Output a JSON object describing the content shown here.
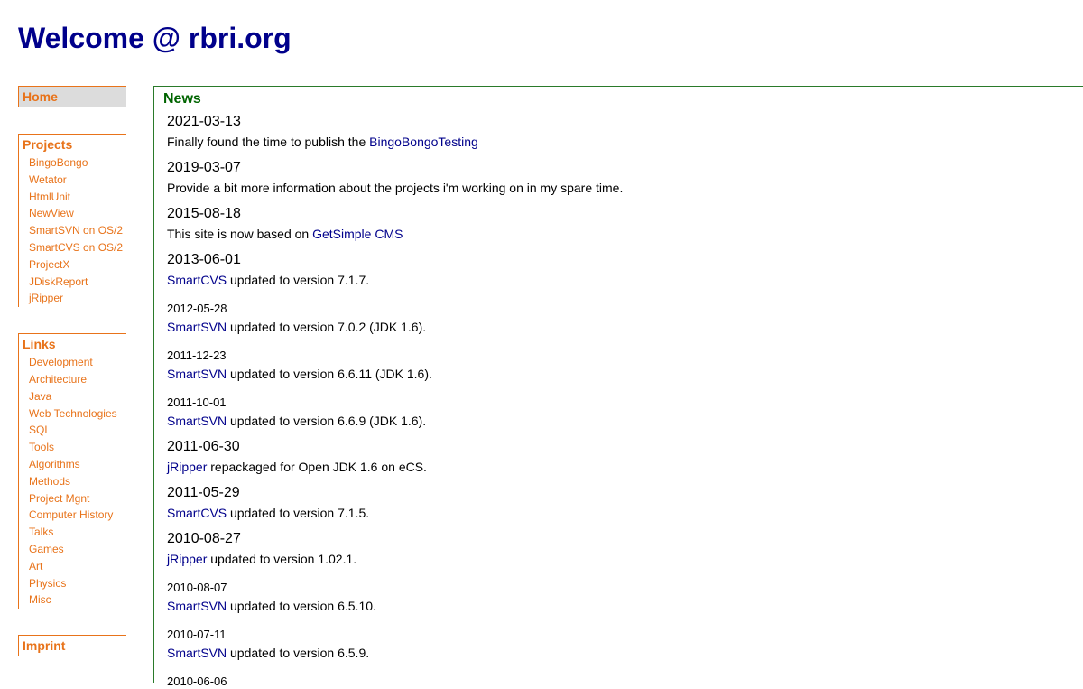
{
  "header": {
    "title": "Welcome @ rbri.org"
  },
  "sidebar": {
    "home": "Home",
    "projects": {
      "heading": "Projects",
      "items": [
        "BingoBongo",
        "Wetator",
        "HtmlUnit",
        "NewView",
        "SmartSVN on OS/2",
        "SmartCVS on OS/2",
        "ProjectX",
        "JDiskReport",
        "jRipper"
      ]
    },
    "links": {
      "heading": "Links",
      "items": [
        "Development",
        "Architecture",
        "Java",
        "Web Technologies",
        "SQL",
        "Tools",
        "Algorithms",
        "Methods",
        "Project Mgnt",
        "Computer History",
        "Talks",
        "Games",
        "Art",
        "Physics",
        "Misc"
      ]
    },
    "imprint": "Imprint"
  },
  "news": {
    "heading": "News",
    "items": [
      {
        "date": "2021-03-13",
        "size": "big",
        "pre": "Finally found the time to publish the ",
        "link": "BingoBongoTesting",
        "post": ""
      },
      {
        "date": "2019-03-07",
        "size": "big",
        "pre": "Provide a bit more information about the projects i'm working on in my spare time.",
        "link": "",
        "post": ""
      },
      {
        "date": "2015-08-18",
        "size": "big",
        "pre": "This site is now based on ",
        "link": "GetSimple CMS",
        "post": ""
      },
      {
        "date": "2013-06-01",
        "size": "big",
        "pre": "",
        "link": "SmartCVS",
        "post": " updated to version 7.1.7."
      },
      {
        "date": "2012-05-28",
        "size": "small",
        "pre": "",
        "link": "SmartSVN",
        "post": " updated to version 7.0.2 (JDK 1.6)."
      },
      {
        "date": "2011-12-23",
        "size": "small",
        "pre": "",
        "link": "SmartSVN",
        "post": " updated to version 6.6.11 (JDK 1.6)."
      },
      {
        "date": "2011-10-01",
        "size": "small",
        "pre": "",
        "link": "SmartSVN",
        "post": " updated to version 6.6.9 (JDK 1.6)."
      },
      {
        "date": "2011-06-30",
        "size": "big",
        "pre": "",
        "link": "jRipper",
        "post": " repackaged for Open JDK 1.6 on eCS."
      },
      {
        "date": "2011-05-29",
        "size": "big",
        "pre": "",
        "link": "SmartCVS",
        "post": " updated to version 7.1.5."
      },
      {
        "date": "2010-08-27",
        "size": "big",
        "pre": "",
        "link": "jRipper",
        "post": " updated to version 1.02.1."
      },
      {
        "date": "2010-08-07",
        "size": "small",
        "pre": "",
        "link": "SmartSVN",
        "post": " updated to version 6.5.10."
      },
      {
        "date": "2010-07-11",
        "size": "small",
        "pre": "",
        "link": "SmartSVN",
        "post": " updated to version 6.5.9."
      },
      {
        "date": "2010-06-06",
        "size": "small",
        "pre": "",
        "link": "",
        "post": ""
      }
    ]
  },
  "colors": {
    "title": "#00008b",
    "sidebar_accent": "#e8731a",
    "news_heading": "#006400",
    "link": "#00008b"
  }
}
